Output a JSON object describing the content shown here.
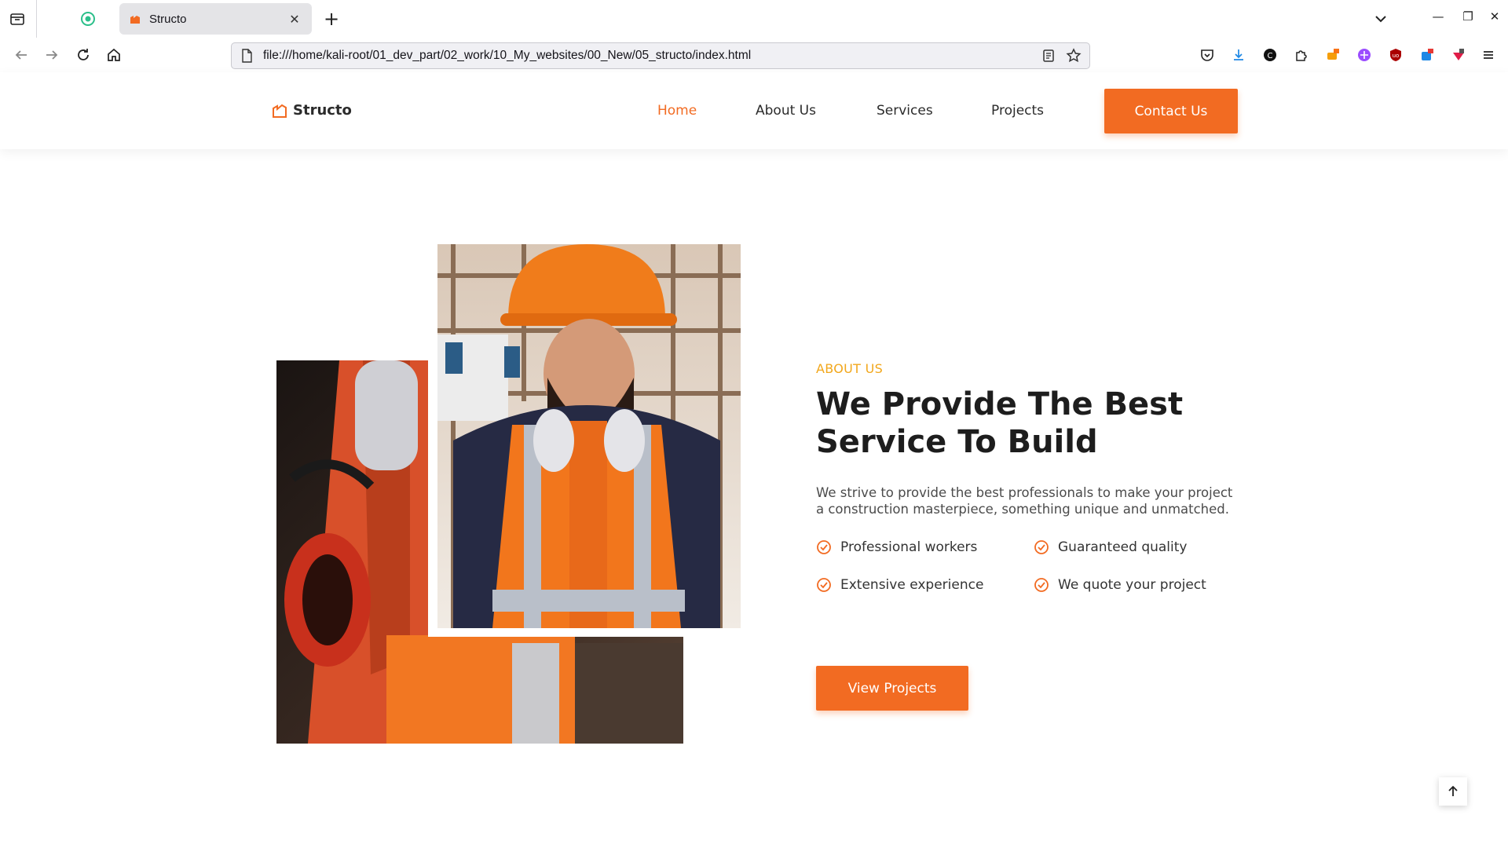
{
  "browser": {
    "tab_title": "Structo",
    "url": "file:///home/kali-root/01_dev_part/02_work/10_My_websites/00_New/05_structo/index.html",
    "new_tab_label": "+",
    "close_tab_label": "✕"
  },
  "site": {
    "logo_text": "Structo",
    "nav": [
      "Home",
      "About Us",
      "Services",
      "Projects"
    ],
    "active_nav": "Home",
    "cta": "Contact Us",
    "accent_color": "#f26b22",
    "eyebrow_color": "#f2a71b"
  },
  "about": {
    "eyebrow": "ABOUT US",
    "heading_line1": "We Provide The Best",
    "heading_line2": "Service To Build",
    "description": "We strive to provide the best professionals to make your project a construction masterpiece, something unique and unmatched.",
    "features": [
      "Professional workers",
      "Guaranteed quality",
      "Extensive experience",
      "We quote your project"
    ],
    "button": "View Projects"
  }
}
